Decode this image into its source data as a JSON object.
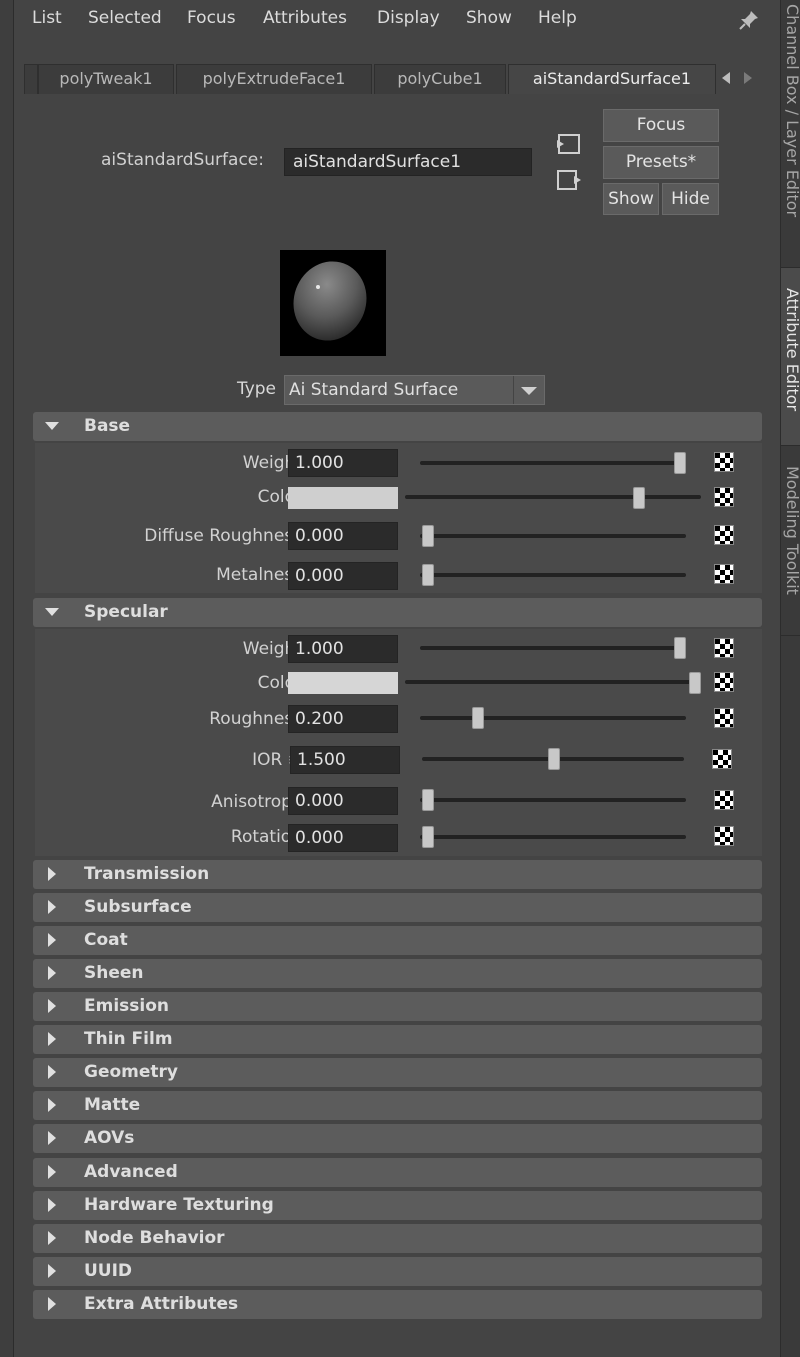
{
  "menubar": {
    "items": [
      "List",
      "Selected",
      "Focus",
      "Attributes",
      "Display",
      "Show",
      "Help"
    ]
  },
  "side_tabs": [
    "Channel Box / Layer Editor",
    "Attribute Editor",
    "Modeling Toolkit"
  ],
  "tabs": [
    "polyTweak1",
    "polyExtrudeFace1",
    "polyCube1",
    "aiStandardSurface1"
  ],
  "active_tab": "aiStandardSurface1",
  "node": {
    "label": "aiStandardSurface:",
    "name": "aiStandardSurface1"
  },
  "buttons": {
    "focus": "Focus",
    "presets": "Presets*",
    "show": "Show",
    "hide": "Hide"
  },
  "type": {
    "label": "Type",
    "value": "Ai Standard Surface"
  },
  "base": {
    "title": "Base",
    "attrs": [
      {
        "label": "Weight",
        "value": "1.000",
        "slider": 1.0
      },
      {
        "label": "Color",
        "color": "#cfcfcf",
        "slider": 0.8
      },
      {
        "label": "Diffuse Roughness",
        "value": "0.000",
        "slider": 0.0
      },
      {
        "label": "Metalness",
        "value": "0.000",
        "slider": 0.0
      }
    ]
  },
  "specular": {
    "title": "Specular",
    "attrs": [
      {
        "label": "Weight",
        "value": "1.000",
        "slider": 1.0
      },
      {
        "label": "Color",
        "color": "#d6d6d6",
        "slider": 1.0
      },
      {
        "label": "Roughness",
        "value": "0.200",
        "slider": 0.2
      },
      {
        "label": "IOR ≡",
        "value": "1.500",
        "slider": 0.5
      },
      {
        "label": "Anisotropy",
        "value": "0.000",
        "slider": 0.0
      },
      {
        "label": "Rotation",
        "value": "0.000",
        "slider": 0.0
      }
    ]
  },
  "collapsed_sections": [
    "Transmission",
    "Subsurface",
    "Coat",
    "Sheen",
    "Emission",
    "Thin Film",
    "Geometry",
    "Matte",
    "AOVs",
    "Advanced",
    "Hardware Texturing",
    "Node Behavior",
    "UUID",
    "Extra Attributes"
  ]
}
